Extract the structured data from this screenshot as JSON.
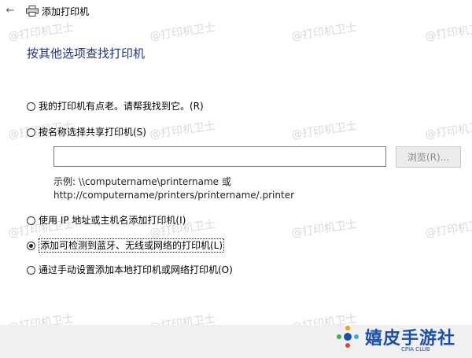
{
  "window": {
    "title": "添加打印机"
  },
  "heading": "按其他选项查找打印机",
  "options": [
    {
      "label": "我的打印机有点老。请帮我找到它。(R)"
    },
    {
      "label": "按名称选择共享打印机(S)"
    },
    {
      "label": "使用 IP 地址或主机名添加打印机(I)"
    },
    {
      "label": "添加可检测到蓝牙、无线或网络的打印机(L)"
    },
    {
      "label": "通过手动设置添加本地打印机或网络打印机(O)"
    }
  ],
  "selected_index": 3,
  "shared_printer": {
    "value": "",
    "browse_label": "浏览(R)...",
    "example_line1": "示例: \\\\computername\\printername 或",
    "example_line2": "http://computername/printers/printername/.printer"
  },
  "watermark": {
    "text": "@打印机卫士"
  },
  "logo": {
    "text": "嬉皮手游社",
    "sub": "CPIA CLUB"
  },
  "colors": {
    "heading": "#1e3287",
    "logo": "#1a4fb0",
    "footer": "#f0f0f0"
  }
}
